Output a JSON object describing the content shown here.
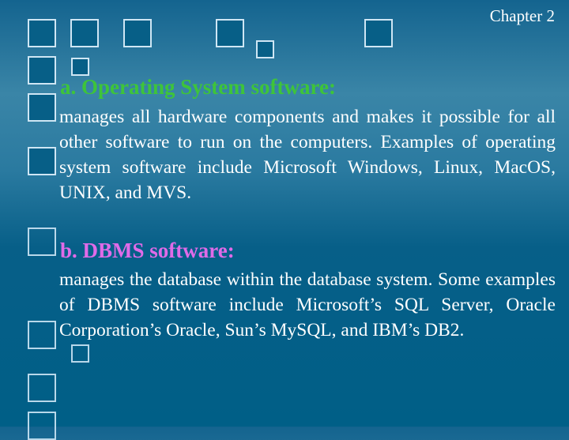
{
  "header": {
    "chapter_label": "Chapter 2"
  },
  "sections": [
    {
      "heading": "a. Operating System software:",
      "heading_color": "#3ec43a",
      "body": "manages all hardware components and makes it possible for all other software to run on the computers. Examples of operating system software include Microsoft Windows, Linux, MacOS, UNIX, and MVS."
    },
    {
      "heading": "b. DBMS software:",
      "heading_color": "#e06be8",
      "body": "manages the database within the database system. Some examples of DBMS software include Microsoft’s SQL Server, Oracle Corporation’s Oracle, Sun’s MySQL, and IBM’s DB2."
    }
  ],
  "theme": {
    "background": "#075f87",
    "text": "#ffffff",
    "square_border": "#cfe6f4"
  }
}
